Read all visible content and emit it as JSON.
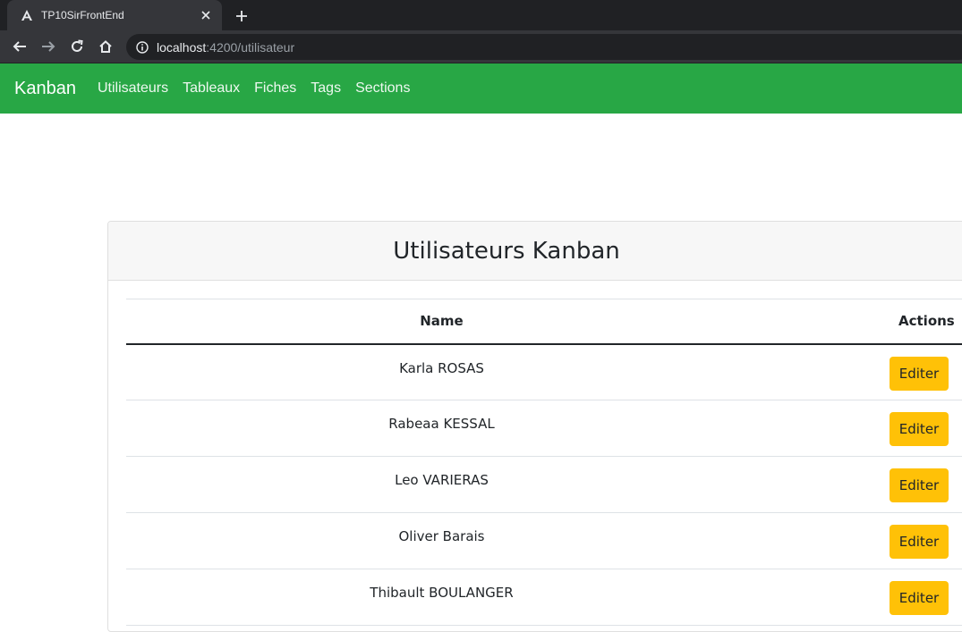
{
  "browser": {
    "tab_title": "TP10SirFrontEnd",
    "url_host": "localhost",
    "url_rest": ":4200/utilisateur"
  },
  "navbar": {
    "brand": "Kanban",
    "links": [
      "Utilisateurs",
      "Tableaux",
      "Fiches",
      "Tags",
      "Sections"
    ],
    "color": "#28a745"
  },
  "card": {
    "title": "Utilisateurs Kanban"
  },
  "table": {
    "headers": {
      "name": "Name",
      "actions": "Actions"
    },
    "rows": [
      {
        "name": "Karla ROSAS",
        "action": "Editer"
      },
      {
        "name": "Rabeaa KESSAL",
        "action": "Editer"
      },
      {
        "name": "Leo VARIERAS",
        "action": "Editer"
      },
      {
        "name": "Oliver Barais",
        "action": "Editer"
      },
      {
        "name": "Thibault BOULANGER",
        "action": "Editer"
      }
    ]
  },
  "colors": {
    "edit_button": "#ffc107"
  },
  "icons": [
    "angular-icon",
    "close-icon",
    "plus-icon",
    "back-icon",
    "forward-icon",
    "reload-icon",
    "home-icon",
    "info-icon"
  ]
}
